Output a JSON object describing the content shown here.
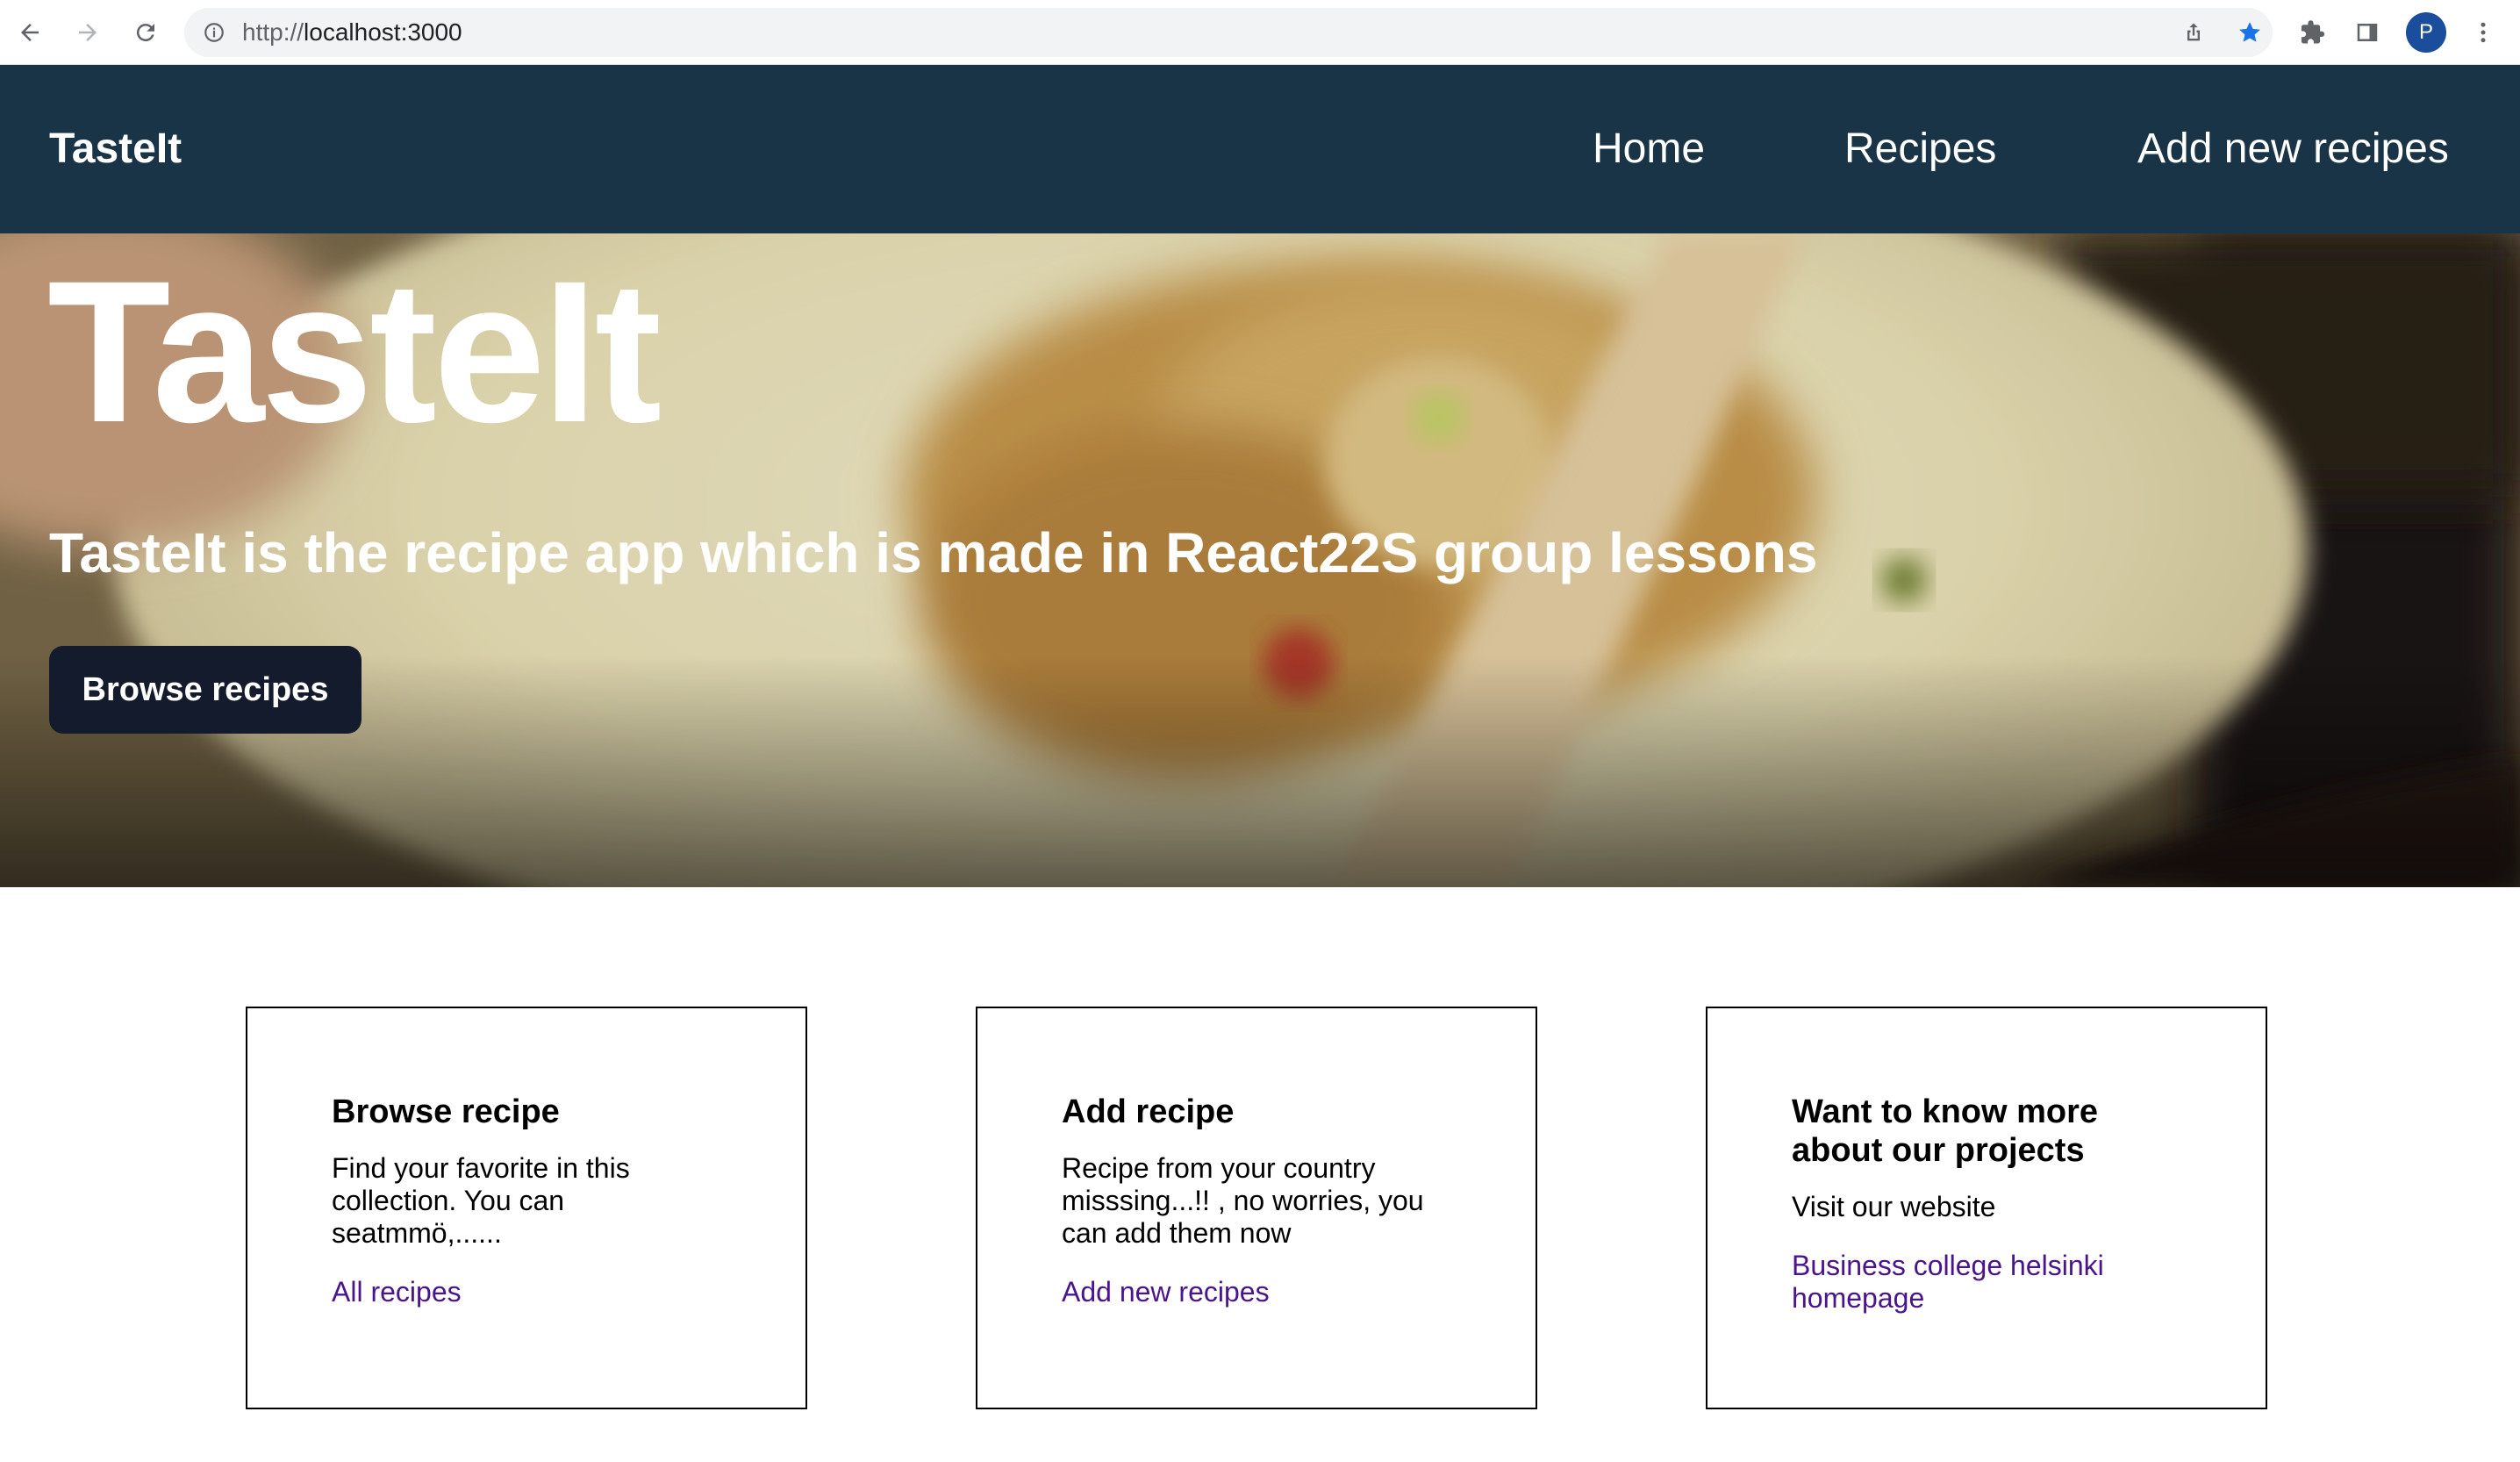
{
  "browser": {
    "url_scheme": "http://",
    "url_host": "localhost",
    "url_rest": ":3000",
    "profile_initial": "P",
    "icons": [
      "back-arrow-icon",
      "forward-arrow-icon",
      "reload-icon",
      "info-icon",
      "share-icon",
      "star-icon",
      "extensions-icon",
      "side-panel-icon",
      "more-vert-icon"
    ],
    "accent_color": "#1a73e8"
  },
  "nav": {
    "brand": "TasteIt",
    "links": [
      "Home",
      "Recipes",
      "Add new recipes"
    ],
    "background_color": "#1a3447"
  },
  "hero": {
    "title": "TasteIt",
    "subtitle": "TasteIt is the recipe app which is made in React22S group lessons",
    "button_label": "Browse recipes"
  },
  "cards": [
    {
      "title": "Browse recipe",
      "text": "Find your favorite in this collection. You can seatmmö,......",
      "link": "All recipes"
    },
    {
      "title": "Add recipe",
      "text": "Recipe from your country misssing...!! , no worries, you can add them now",
      "link": "Add new recipes"
    },
    {
      "title": "Want to know more about our projects",
      "text": "Visit our website",
      "link": "Business college helsinki homepage"
    }
  ],
  "link_color": "#4a148c"
}
